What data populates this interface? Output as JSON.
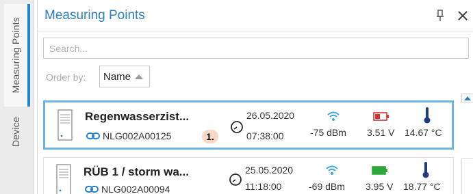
{
  "side_tabs": [
    {
      "label": "Measuring Points",
      "active": true
    },
    {
      "label": "Device",
      "active": false
    }
  ],
  "panel": {
    "title": "Measuring Points",
    "pin_icon": "pin-icon",
    "close_icon": "close-icon"
  },
  "search": {
    "placeholder": "Search...",
    "value": ""
  },
  "order_by": {
    "label": "Order by:",
    "selected": "Name",
    "direction_icon": "sort-ascending-icon"
  },
  "items": [
    {
      "name": "Regenwasserzist...",
      "serial": "NLG002A00125",
      "annotation": "1.",
      "date": "26.05.2020",
      "time": "07:38:00",
      "signal": "-75 dBm",
      "voltage": "3.51 V",
      "battery_color": "#d9322b",
      "temperature": "14.67 °C",
      "selected": true
    },
    {
      "name": "RÜB 1 / storm wa...",
      "serial": "NLG002A00094",
      "date": "25.05.2020",
      "time": "11:18:00",
      "signal": "-69 dBm",
      "voltage": "3.95 V",
      "battery_color": "#2ea83a",
      "temperature": "18.77 °C",
      "selected": false
    }
  ],
  "colors": {
    "accent": "#2b7fc3",
    "selection_border": "#6ab4e6",
    "wifi": "#3aa6e6",
    "thermometer": "#1f3d7a"
  }
}
